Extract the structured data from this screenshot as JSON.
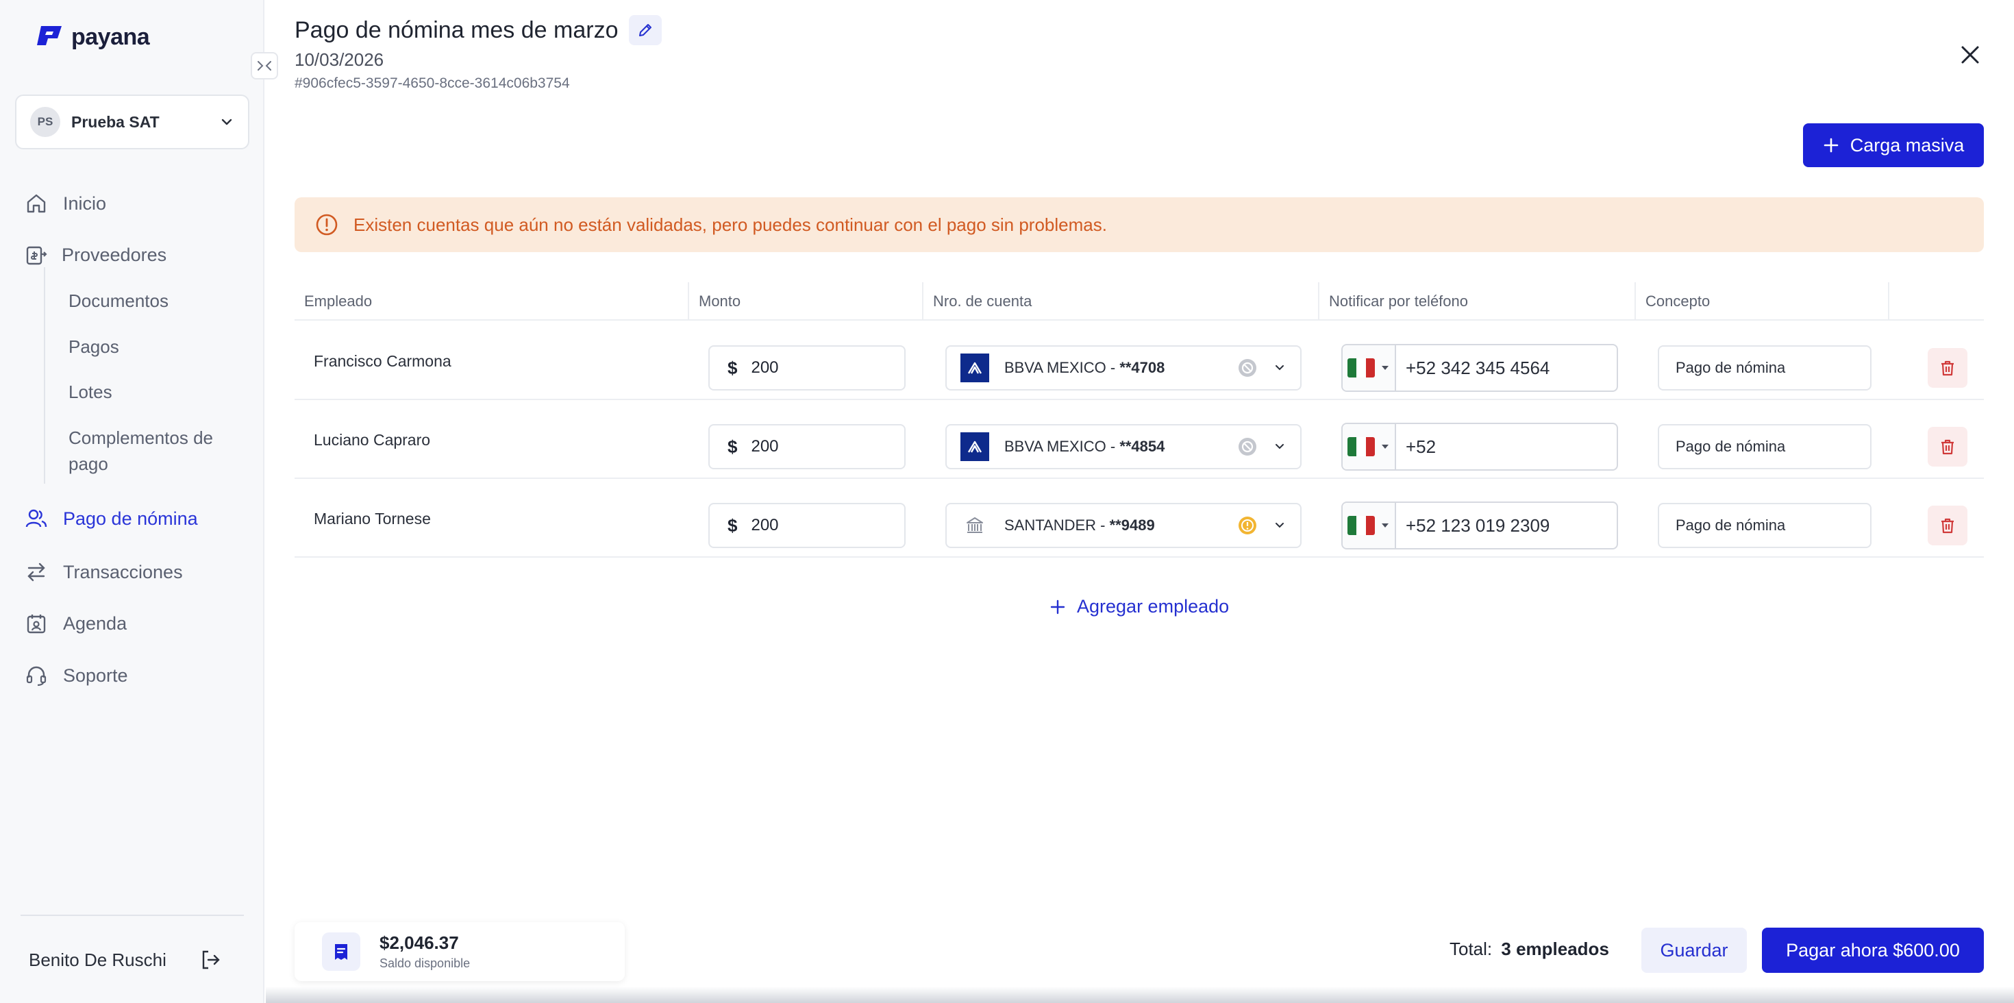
{
  "brand": {
    "name": "payana",
    "accent": "#1c22d6"
  },
  "company": {
    "initials": "PS",
    "name": "Prueba SAT"
  },
  "nav": {
    "inicio": "Inicio",
    "proveedores": "Proveedores",
    "documentos": "Documentos",
    "pagos": "Pagos",
    "lotes": "Lotes",
    "complementos_1": "Complementos de",
    "complementos_2": "pago",
    "pago_nomina": "Pago de nómina",
    "transacciones": "Transacciones",
    "agenda": "Agenda",
    "soporte": "Soporte"
  },
  "user": {
    "name": "Benito De Ruschi"
  },
  "header": {
    "title": "Pago de nómina mes de marzo",
    "date": "10/03/2026",
    "id": "#906cfec5-3597-4650-8cce-3614c06b3754",
    "bulk_label": "Carga masiva"
  },
  "alert": {
    "text": "Existen cuentas que aún no están validadas, pero puedes continuar con el pago sin problemas."
  },
  "table": {
    "columns": [
      "Empleado",
      "Monto",
      "Nro. de cuenta",
      "Notificar por teléfono",
      "Concepto"
    ],
    "rows": [
      {
        "name": "Francisco Carmona",
        "amount": "200",
        "bank": "BBVA MEXICO - ",
        "acct": "**4708",
        "phone": "+52 342 345 4564",
        "concept": "Pago de nómina"
      },
      {
        "name": "Luciano Capraro",
        "amount": "200",
        "bank": "BBVA MEXICO - ",
        "acct": "**4854",
        "phone": "+52",
        "concept": "Pago de nómina"
      },
      {
        "name": "Mariano Tornese",
        "amount": "200",
        "bank": "SANTANDER - ",
        "acct": "**9489",
        "phone": "+52 123 019 2309",
        "concept": "Pago de nómina"
      }
    ],
    "add_label": "Agregar empleado"
  },
  "footer": {
    "balance": "$2,046.37",
    "balance_label": "Saldo disponible",
    "total_label": "Total:",
    "total_value": "3 empleados",
    "save_label": "Guardar",
    "pay_label": "Pagar ahora $600.00"
  },
  "icons": [
    "collapse-icon",
    "chevron-down-icon",
    "home-icon",
    "supplier-icon",
    "users-icon",
    "transfer-icon",
    "calendar-icon",
    "support-icon",
    "logout-icon",
    "pencil-icon",
    "close-icon",
    "plus-icon",
    "alert-icon",
    "bbva-logo-icon",
    "bank-icon",
    "status-icon",
    "mexico-flag-icon",
    "trash-icon",
    "receipt-icon"
  ]
}
